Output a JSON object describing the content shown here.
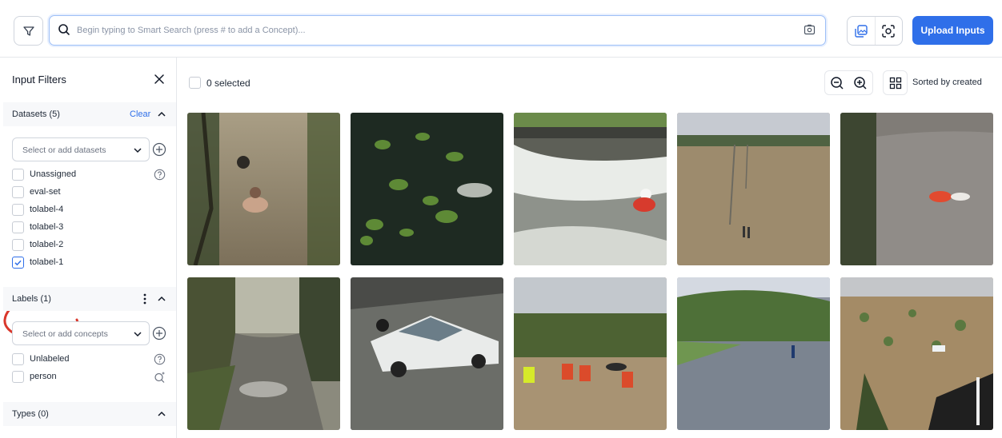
{
  "topbar": {
    "search_placeholder": "Begin typing to Smart Search (press # to add a Concept)...",
    "upload_label": "Upload Inputs",
    "icons": [
      "filter-icon",
      "search-icon",
      "image-search-icon",
      "gallery-view-icon",
      "object-view-icon"
    ]
  },
  "sidebar": {
    "title": "Input Filters",
    "datasets": {
      "label": "Datasets (5)",
      "clear_label": "Clear",
      "select_placeholder": "Select or add datasets",
      "items": [
        {
          "label": "Unassigned",
          "checked": false
        },
        {
          "label": "eval-set",
          "checked": false
        },
        {
          "label": "tolabel-4",
          "checked": false
        },
        {
          "label": "tolabel-3",
          "checked": false
        },
        {
          "label": "tolabel-2",
          "checked": false
        },
        {
          "label": "tolabel-1",
          "checked": true
        }
      ]
    },
    "labels": {
      "label": "Labels (1)",
      "select_placeholder": "Select or add concepts",
      "items": [
        {
          "label": "Unlabeled",
          "checked": false
        },
        {
          "label": "person",
          "checked": false
        }
      ]
    },
    "types": {
      "label": "Types (0)"
    }
  },
  "main": {
    "selected_label": "0 selected",
    "sort_label": "Sorted by created"
  },
  "colors": {
    "accent": "#2f6fe9",
    "annotation": "#d9372b"
  }
}
